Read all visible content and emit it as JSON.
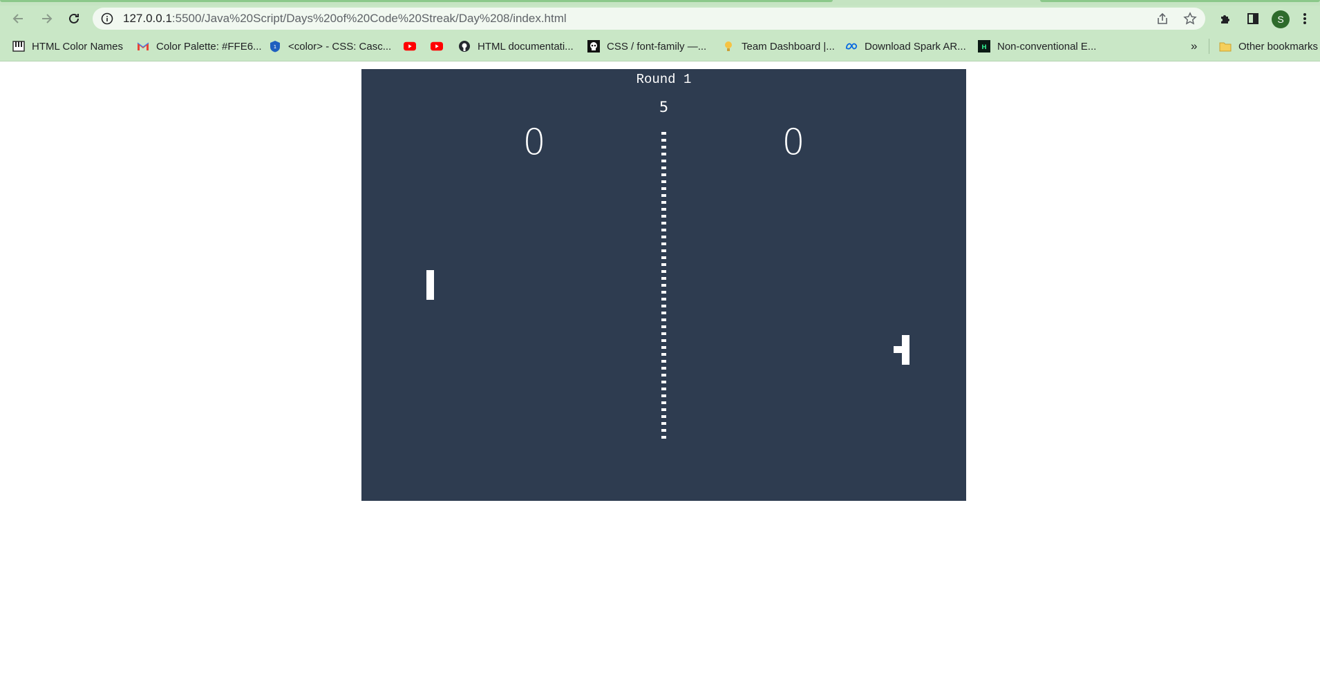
{
  "browser": {
    "url_host": "127.0.0.1",
    "url_path": ":5500/Java%20Script/Days%20of%20Code%20Streak/Day%208/index.html",
    "profile_initial": "S",
    "theme_color": "#c9e7c6"
  },
  "bookmarks": {
    "items": [
      {
        "label": "HTML Color Names",
        "icon": "piano-icon"
      },
      {
        "label": "Color Palette: #FFE6...",
        "icon": "gmail-icon"
      },
      {
        "label": "<color> - CSS: Casc...",
        "icon": "mdn-shield-icon"
      },
      {
        "label": "",
        "icon": "youtube-icon"
      },
      {
        "label": "",
        "icon": "youtube-icon"
      },
      {
        "label": "HTML documentati...",
        "icon": "github-icon"
      },
      {
        "label": "CSS / font-family —...",
        "icon": "skull-icon"
      },
      {
        "label": "Team Dashboard |...",
        "icon": "lightbulb-icon"
      },
      {
        "label": "Download Spark AR...",
        "icon": "meta-icon"
      },
      {
        "label": "Non-conventional E...",
        "icon": "hb-icon"
      }
    ],
    "overflow": "»",
    "other_label": "Other bookmarks"
  },
  "game": {
    "round_label": "Round 1",
    "timer": "5",
    "score_left": "0",
    "score_right": "0",
    "background_color": "#2e3c50"
  }
}
